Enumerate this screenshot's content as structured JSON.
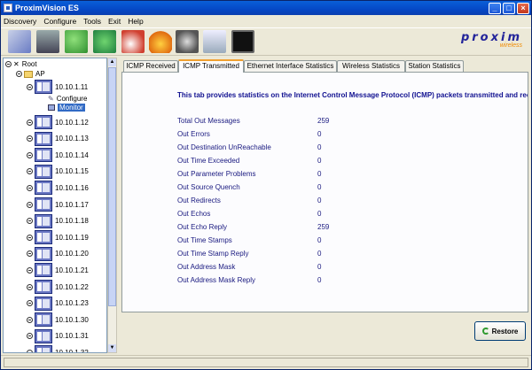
{
  "window": {
    "title": "ProximVision ES"
  },
  "menu": [
    "Discovery",
    "Configure",
    "Tools",
    "Exit",
    "Help"
  ],
  "toolbar": {
    "buttons": [
      "network-discovery-icon",
      "switch-icon",
      "arrow-right-icon",
      "refresh-icon",
      "scheduler-icon",
      "alarm-bell-icon",
      "settings-device-icon",
      "report-icon",
      "monitor-screen-icon"
    ]
  },
  "logo": {
    "name": "proxim",
    "tagline": "wireless",
    "color": "#22239a",
    "accent": "#f08a00"
  },
  "tree": {
    "root": "Root",
    "ap": "AP",
    "selected_device": "10.10.1.11",
    "children": [
      "Configure",
      "Monitor"
    ],
    "devices": [
      "10.10.1.12",
      "10.10.1.13",
      "10.10.1.14",
      "10.10.1.15",
      "10.10.1.16",
      "10.10.1.17",
      "10.10.1.18",
      "10.10.1.19",
      "10.10.1.20",
      "10.10.1.21",
      "10.10.1.22",
      "10.10.1.23",
      "10.10.1.30",
      "10.10.1.31",
      "10.10.1.32"
    ]
  },
  "tabs": [
    "ICMP Received",
    "ICMP Transmitted",
    "Ethernet Interface Statistics",
    "Wireless Statistics",
    "Station Statistics"
  ],
  "active_tab": "ICMP Transmitted",
  "panel": {
    "description": "This tab provides statistics on the Internet Control Message Protocol (ICMP) packets transmitted and receive",
    "stats": [
      {
        "label": "Total Out Messages",
        "value": "259"
      },
      {
        "label": "Out Errors",
        "value": "0"
      },
      {
        "label": "Out Destination UnReachable",
        "value": "0"
      },
      {
        "label": "Out Time Exceeded",
        "value": "0"
      },
      {
        "label": "Out Parameter Problems",
        "value": "0"
      },
      {
        "label": "Out Source Quench",
        "value": "0"
      },
      {
        "label": "Out Redirects",
        "value": "0"
      },
      {
        "label": "Out Echos",
        "value": "0"
      },
      {
        "label": "Out Echo Reply",
        "value": "259"
      },
      {
        "label": "Out Time Stamps",
        "value": "0"
      },
      {
        "label": "Out Time Stamp Reply",
        "value": "0"
      },
      {
        "label": "Out Address Mask",
        "value": "0"
      },
      {
        "label": "Out Address Mask Reply",
        "value": "0"
      }
    ]
  },
  "restore_label": "Restore"
}
